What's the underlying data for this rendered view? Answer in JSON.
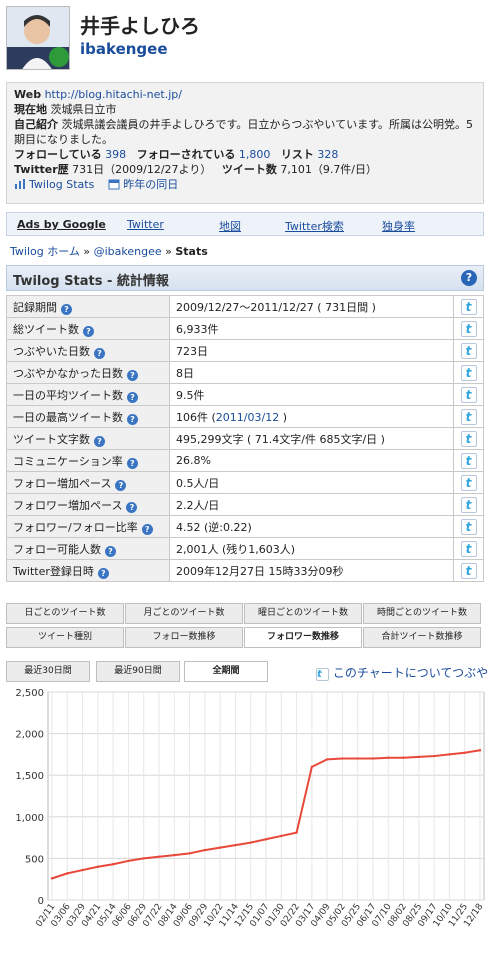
{
  "profile": {
    "display_name": "井手よしひろ",
    "screen_name": "ibakengee",
    "web_label": "Web",
    "web_url": "http://blog.hitachi-net.jp/",
    "location_label": "現在地",
    "location": "茨城県日立市",
    "bio_label": "自己紹介",
    "bio": "茨城県議会議員の井手よしひろです。日立からつぶやいています。所属は公明党。5期目になりました。",
    "following_label": "フォローしている",
    "following": "398",
    "followers_label": "フォローされている",
    "followers": "1,800",
    "lists_label": "リスト",
    "lists": "328",
    "history_label": "Twitter歴",
    "history": "731日（2009/12/27より）",
    "tweets_label": "ツイート数",
    "tweets": "7,101（9.7件/日）",
    "twilog_stats_link": "Twilog Stats",
    "last_year_link": "昨年の同日"
  },
  "adbar": {
    "ads_by": "Ads by Google",
    "links": [
      "Twitter",
      "地図",
      "Twitter検索",
      "独身率"
    ]
  },
  "breadcrumb": {
    "home": "Twilog ホーム",
    "sep": "»",
    "user": "@ibakengee",
    "current": "Stats"
  },
  "stats": {
    "title": "Twilog Stats - 統計情報",
    "rows": [
      {
        "label": "記録期間",
        "value": "2009/12/27〜2011/12/27 ( 731日間 )"
      },
      {
        "label": "総ツイート数",
        "value": "6,933件"
      },
      {
        "label": "つぶやいた日数",
        "value": "723日"
      },
      {
        "label": "つぶやかなかった日数",
        "value": "8日"
      },
      {
        "label": "一日の平均ツイート数",
        "value": "9.5件"
      },
      {
        "label": "一日の最高ツイート数",
        "value": "106件 (",
        "link": "2011/03/12",
        "suffix": " )"
      },
      {
        "label": "ツイート文字数",
        "value": "495,299文字 ( 71.4文字/件 685文字/日 )"
      },
      {
        "label": "コミュニケーション率",
        "value": "26.8%"
      },
      {
        "label": "フォロー増加ペース",
        "value": "0.5人/日"
      },
      {
        "label": "フォロワー増加ペース",
        "value": "2.2人/日"
      },
      {
        "label": "フォロワー/フォロー比率",
        "value": "4.52 (逆:0.22)"
      },
      {
        "label": "フォロー可能人数",
        "value": "2,001人 (残り1,603人)"
      },
      {
        "label": "Twitter登録日時",
        "value": "2009年12月27日 15時33分09秒"
      }
    ]
  },
  "chart_tabs": {
    "row1": [
      "日ごとのツイート数",
      "月ごとのツイート数",
      "曜日ごとのツイート数",
      "時間ごとのツイート数"
    ],
    "row2": [
      "ツイート種別",
      "フォロー数推移",
      "フォロワー数推移",
      "合計ツイート数推移"
    ],
    "active": "フォロワー数推移"
  },
  "ranges": {
    "buttons": [
      "最近30日間",
      "最近90日間",
      "全期間"
    ],
    "active": "全期間",
    "tweet_link": "このチャートについてつぶやく"
  },
  "colors": {
    "accent": "#1a4c9c",
    "line": "#e8493a"
  },
  "chart_data": {
    "type": "line",
    "title": "",
    "xlabel": "",
    "ylabel": "",
    "ylim": [
      0,
      2500
    ],
    "yticks": [
      "0",
      "500",
      "1,000",
      "1,500",
      "2,000",
      "2,500"
    ],
    "grid": true,
    "x": [
      "02/11",
      "03/06",
      "03/29",
      "04/21",
      "05/14",
      "06/06",
      "06/29",
      "07/22",
      "08/14",
      "09/06",
      "09/29",
      "10/22",
      "11/14",
      "12/15",
      "01/07",
      "01/30",
      "02/22",
      "03/17",
      "04/09",
      "05/02",
      "05/25",
      "06/17",
      "07/10",
      "08/02",
      "08/25",
      "09/17",
      "10/10",
      "11/25",
      "12/18"
    ],
    "series": [
      {
        "values": [
          260,
          320,
          360,
          400,
          430,
          470,
          500,
          520,
          540,
          560,
          600,
          630,
          660,
          690,
          730,
          770,
          810,
          1600,
          1690,
          1700,
          1700,
          1700,
          1710,
          1710,
          1720,
          1730,
          1750,
          1770,
          1800
        ]
      }
    ]
  }
}
